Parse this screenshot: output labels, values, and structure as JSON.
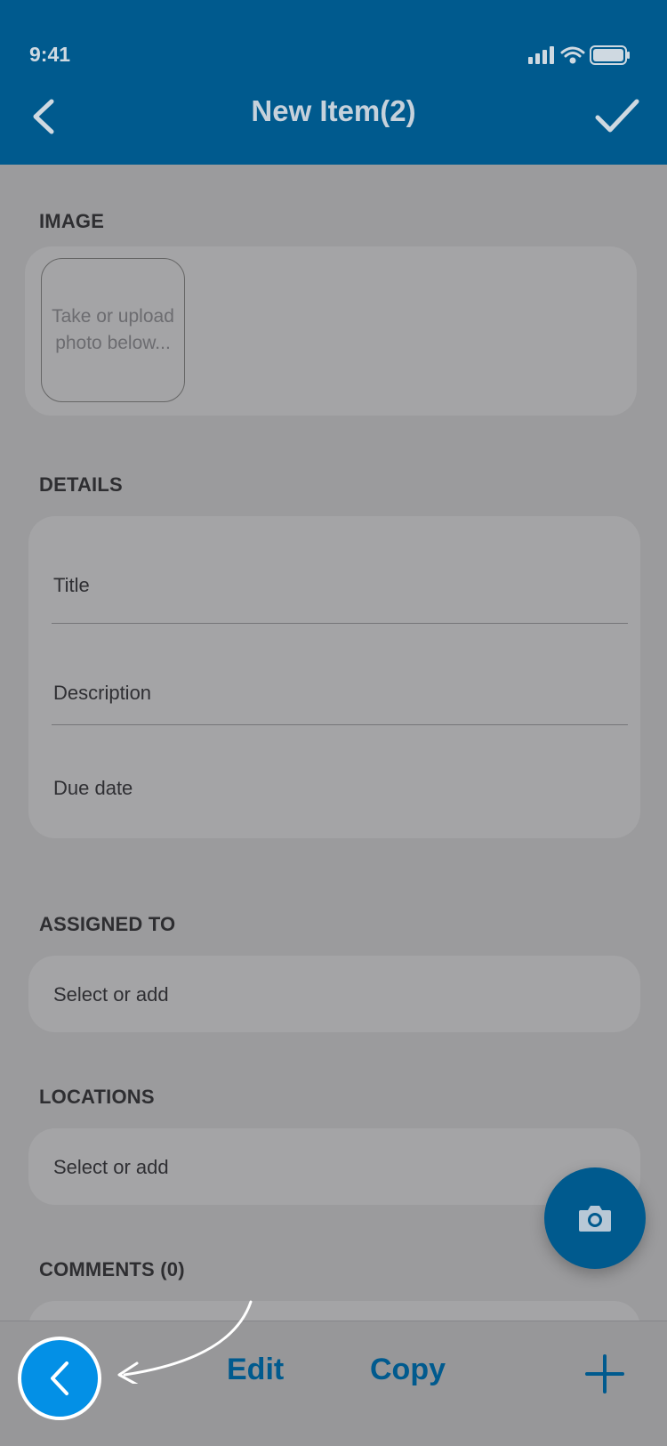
{
  "status": {
    "time": "9:41"
  },
  "nav": {
    "title": "New Item(2)"
  },
  "sections": {
    "image": {
      "label": "IMAGE",
      "placeholder_line1": "Take or upload",
      "placeholder_line2": "photo below..."
    },
    "details": {
      "label": "DETAILS",
      "title": "Title",
      "description": "Description",
      "due_date": "Due date"
    },
    "assigned": {
      "label": "ASSIGNED TO",
      "select": "Select or add"
    },
    "locations": {
      "label": "LOCATIONS",
      "select": "Select or add"
    },
    "comments": {
      "label": "COMMENTS (0)"
    }
  },
  "toolbar": {
    "edit": "Edit",
    "copy": "Copy"
  },
  "icons": {
    "back": "chevron-left-icon",
    "check": "check-icon",
    "camera": "camera-icon",
    "plus": "plus-icon",
    "signal": "signal-icon",
    "wifi": "wifi-icon",
    "battery": "battery-icon"
  },
  "colors": {
    "brand": "#005a8e",
    "accent": "#0390e6",
    "overlay": "#9b9b9d"
  }
}
